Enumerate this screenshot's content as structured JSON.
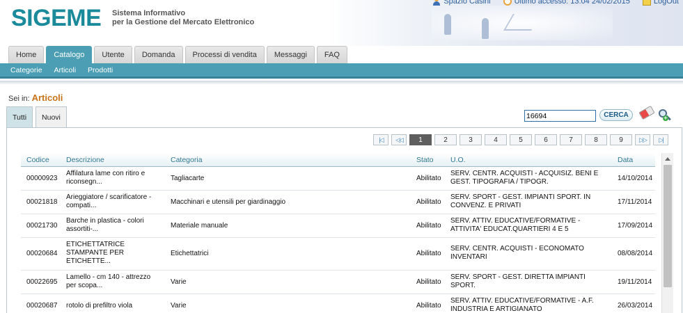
{
  "header": {
    "logo": "SIGEME",
    "subtitle_line1": "Sistema Informativo",
    "subtitle_line2": "per la Gestione del Mercato Elettronico",
    "user": "Spazio Casini",
    "last_access": "Ultimo accesso: 13:04 24/02/2015",
    "logout": "LogOut"
  },
  "tabs": [
    "Home",
    "Catalogo",
    "Utente",
    "Domanda",
    "Processi di vendita",
    "Messaggi",
    "FAQ"
  ],
  "active_tab": "Catalogo",
  "subnav": [
    "Categorie",
    "Articoli",
    "Prodotti"
  ],
  "breadcrumb": {
    "prefix": "Sei in:",
    "current": "Articoli"
  },
  "filter_tabs": [
    "Tutti",
    "Nuovi"
  ],
  "search": {
    "value": "16694",
    "button": "CERCA"
  },
  "pager": {
    "first": "|◁",
    "prev": "◁◁",
    "pages": [
      "1",
      "2",
      "3",
      "4",
      "5",
      "6",
      "7",
      "8",
      "9"
    ],
    "current": "1",
    "next": "▷▷",
    "last": "▷|"
  },
  "table": {
    "columns": [
      "Codice",
      "Descrizione",
      "Categoria",
      "Stato",
      "U.O.",
      "Data"
    ],
    "rows": [
      {
        "codice": "00000923",
        "descrizione": "Affilatura lame con ritiro e riconsegn...",
        "categoria": "Tagliacarte",
        "stato": "Abilitato",
        "uo": "SERV. CENTR. ACQUISTI - ACQUISIZ. BENI E GEST. TIPOGRAFIA / TIPOGR.",
        "data": "14/10/2014"
      },
      {
        "codice": "00021818",
        "descrizione": "Arieggiatore / scarificatore - compati...",
        "categoria": "Macchinari e utensili per giardinaggio",
        "stato": "Abilitato",
        "uo": "SERV. SPORT - GEST. IMPIANTI SPORT. IN CONVENZ. E PRIVATI",
        "data": "17/11/2014"
      },
      {
        "codice": "00021730",
        "descrizione": "Barche in plastica - colori assortiti-...",
        "categoria": "Materiale manuale",
        "stato": "Abilitato",
        "uo": "SERV. ATTIV. EDUCATIVE/FORMATIVE - ATTIVITA' EDUCAT.QUARTIERI 4 E 5",
        "data": "17/09/2014"
      },
      {
        "codice": "00020684",
        "descrizione": "ETICHETTATRICE STAMPANTE PER ETICHETTE...",
        "categoria": "Etichettatrici",
        "stato": "Abilitato",
        "uo": "SERV. CENTR. ACQUISTI - ECONOMATO INVENTARI",
        "data": "08/08/2014"
      },
      {
        "codice": "00022695",
        "descrizione": "Lamello - cm 140 - attrezzo per scopa...",
        "categoria": "Varie",
        "stato": "Abilitato",
        "uo": "SERV. SPORT - GEST. DIRETTA IMPIANTI SPORT.",
        "data": "19/11/2014"
      },
      {
        "codice": "00020687",
        "descrizione": "rotolo di prefiltro viola",
        "categoria": "Varie",
        "stato": "Abilitato",
        "uo": "SERV. ATTIV. EDUCATIVE/FORMATIVE - A.F. INDUSTRIA E ARTIGIANATO",
        "data": "26/03/2014"
      }
    ]
  },
  "colors": {
    "teal": "#4b9eb3",
    "logo": "#1b8a9a",
    "accent_orange": "#c8721a",
    "header_text": "#2f7791"
  }
}
